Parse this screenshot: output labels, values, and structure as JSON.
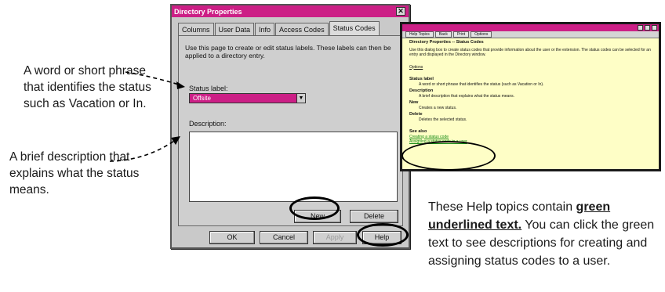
{
  "callouts": {
    "status_label": "A word or short phrase that identifies the status such as Vacation or In.",
    "description": "A brief description that explains what the status means.",
    "help_pre": "These Help topics contain ",
    "help_green": "green underlined text.",
    "help_post": " You can click the green text to see descriptions for creating and assigning status codes to a user."
  },
  "dialog": {
    "title": "Directory Properties",
    "close": "✕",
    "tabs": [
      "Columns",
      "User Data",
      "Info",
      "Access Codes",
      "Status Codes"
    ],
    "active_tab": "Status Codes",
    "intro": "Use this page to create or edit status labels. These labels can then be applied to a directory entry.",
    "status_label": "Status label:",
    "status_value": "Offsite",
    "description_label": "Description:",
    "description_value": "",
    "new_button": "New",
    "delete_button": "Delete",
    "ok_button": "OK",
    "cancel_button": "Cancel",
    "apply_button": "Apply",
    "help_button": "Help"
  },
  "help_window": {
    "toolbar": [
      "Help Topics",
      "Back",
      "Print",
      "Options"
    ],
    "heading": "Directory Properties -- Status Codes",
    "intro": "Use this dialog box to create status codes that provide information about the user or the extension. The status codes can be selected for an entry and displayed in the Directory window.",
    "options": "Options",
    "items": [
      {
        "term": "Status label",
        "def": "A word or short phrase that identifies the status (such as Vacation or In)."
      },
      {
        "term": "Description",
        "def": "A brief description that explains what the status means."
      },
      {
        "term": "New",
        "def": "Creates a new status."
      },
      {
        "term": "Delete",
        "def": "Deletes the selected status."
      }
    ],
    "see_also": "See also",
    "links": [
      "Creating a status code",
      "Assigning a status code to a user"
    ]
  }
}
